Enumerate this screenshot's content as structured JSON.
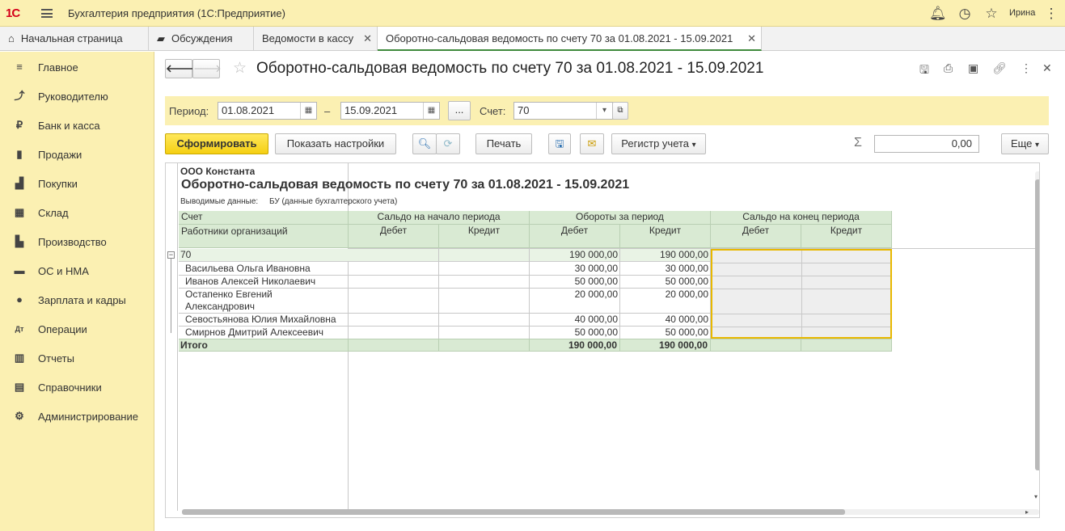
{
  "app": {
    "logo": "1С",
    "title": "Бухгалтерия предприятия (1С:Предприятие)",
    "user": "Ирина"
  },
  "icons": {
    "menu": "menu-icon",
    "bell": "bell-icon",
    "history": "history-icon",
    "star": "star-icon",
    "more": "more-vert-icon"
  },
  "tabs": [
    {
      "label": "Начальная страница"
    },
    {
      "label": "Обсуждения"
    },
    {
      "label": "Ведомости в кассу"
    },
    {
      "label": "Оборотно-сальдовая ведомость по счету 70 за 01.08.2021 - 15.09.2021"
    }
  ],
  "sidebar": {
    "items": [
      {
        "label": "Главное",
        "icon": "≡"
      },
      {
        "label": "Руководителю",
        "icon": "⤴"
      },
      {
        "label": "Банк и касса",
        "icon": "₽"
      },
      {
        "label": "Продажи",
        "icon": "▮"
      },
      {
        "label": "Покупки",
        "icon": "▟"
      },
      {
        "label": "Склад",
        "icon": "▦"
      },
      {
        "label": "Производство",
        "icon": "▙"
      },
      {
        "label": "ОС и НМА",
        "icon": "▬"
      },
      {
        "label": "Зарплата и кадры",
        "icon": "●"
      },
      {
        "label": "Операции",
        "icon": "Дт"
      },
      {
        "label": "Отчеты",
        "icon": "▥"
      },
      {
        "label": "Справочники",
        "icon": "▤"
      },
      {
        "label": "Администрирование",
        "icon": "⚙"
      }
    ]
  },
  "form": {
    "title": "Оборотно-сальдовая ведомость по счету 70 за 01.08.2021 - 15.09.2021",
    "period_label": "Период:",
    "period_from": "01.08.2021",
    "dash": "–",
    "period_to": "15.09.2021",
    "ellipsis": "...",
    "account_label": "Счет:",
    "account": "70",
    "generate": "Сформировать",
    "show_settings": "Показать настройки",
    "print": "Печать",
    "register": "Регистр учета",
    "sum_value": "0,00",
    "more": "Еще"
  },
  "report": {
    "org": "ООО Константа",
    "title": "Оборотно-сальдовая ведомость по счету 70 за 01.08.2021 - 15.09.2021",
    "output_label": "Выводимые данные:",
    "output_value": "БУ (данные бухгалтерского учета)",
    "h_account": "Счет",
    "h_workers": "Работники организаций",
    "h_start": "Сальдо на начало периода",
    "h_turnover": "Обороты за период",
    "h_end": "Сальдо на конец периода",
    "h_debit": "Дебет",
    "h_credit": "Кредит",
    "group": {
      "name": "70",
      "turn_debit": "190 000,00",
      "turn_credit": "190 000,00"
    },
    "rows": [
      {
        "name": "Васильева Ольга Ивановна",
        "turn_debit": "30 000,00",
        "turn_credit": "30 000,00"
      },
      {
        "name": "Иванов Алексей Николаевич",
        "turn_debit": "50 000,00",
        "turn_credit": "50 000,00"
      },
      {
        "name": "Остапенко Евгений",
        "name2": "Александрович",
        "turn_debit": "20 000,00",
        "turn_credit": "20 000,00"
      },
      {
        "name": "Севостьянова Юлия Михайловна",
        "turn_debit": "40 000,00",
        "turn_credit": "40 000,00"
      },
      {
        "name": "Смирнов Дмитрий Алексеевич",
        "turn_debit": "50 000,00",
        "turn_credit": "50 000,00"
      }
    ],
    "total": {
      "name": "Итого",
      "turn_debit": "190 000,00",
      "turn_credit": "190 000,00"
    }
  }
}
